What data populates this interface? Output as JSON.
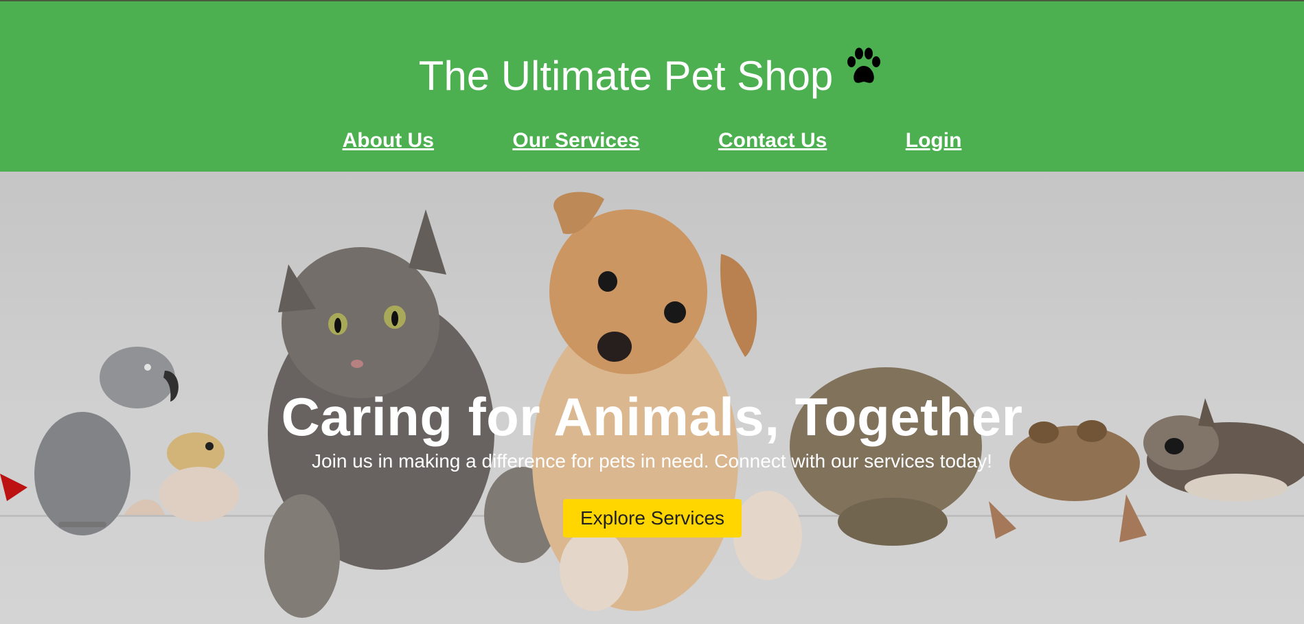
{
  "header": {
    "title": "The Ultimate Pet Shop",
    "title_icon": "paw-icon",
    "background": "#4caf50"
  },
  "nav": {
    "items": [
      {
        "label": "About Us"
      },
      {
        "label": "Our Services"
      },
      {
        "label": "Contact Us"
      },
      {
        "label": "Login"
      }
    ]
  },
  "hero": {
    "heading": "Caring for Animals, Together",
    "subheading": "Join us in making a difference for pets in need. Connect with our services today!",
    "cta_label": "Explore Services",
    "cta_color": "#ffd600",
    "image_subjects": [
      "parrot",
      "gecko",
      "cat",
      "puppy",
      "rabbit",
      "frog",
      "sugar-glider"
    ]
  }
}
